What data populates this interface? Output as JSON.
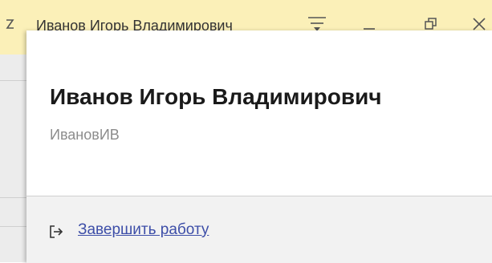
{
  "titlebar": {
    "user_name": "Иванов Игорь Владимирович",
    "icons": {
      "left": "partial-glyph-icon",
      "menu": "menu-icon",
      "minimize": "minimize-icon",
      "restore": "restore-icon",
      "close": "close-icon"
    },
    "background_color": "#fbf0b8"
  },
  "popup": {
    "full_name": "Иванов Игорь Владимирович",
    "login": "ИвановИВ",
    "logout_label": "Завершить работу",
    "logout_icon": "exit-icon",
    "link_color": "#3d4ea8"
  }
}
